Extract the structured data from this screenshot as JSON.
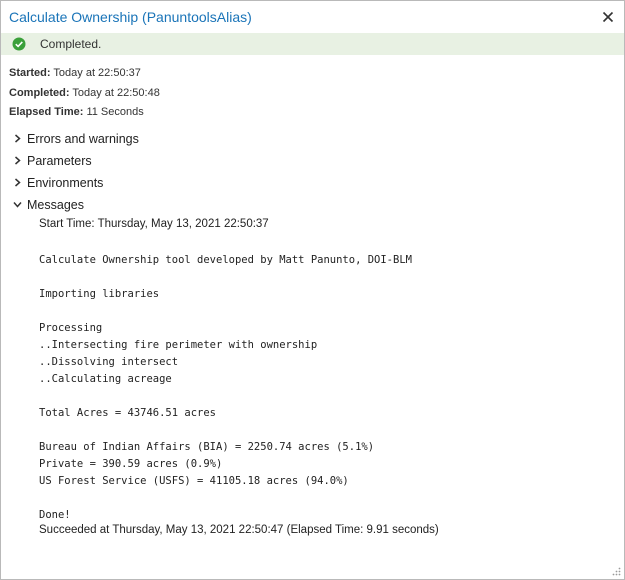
{
  "window": {
    "title": "Calculate Ownership (PanuntoolsAlias)"
  },
  "status": {
    "text": "Completed.",
    "color": "#3aa03a"
  },
  "meta": {
    "started_label": "Started:",
    "started_value": "Today at 22:50:37",
    "completed_label": "Completed:",
    "completed_value": "Today at 22:50:48",
    "elapsed_label": "Elapsed Time:",
    "elapsed_value": "11 Seconds"
  },
  "sections": {
    "errors": "Errors and warnings",
    "parameters": "Parameters",
    "environments": "Environments",
    "messages": "Messages"
  },
  "messages": {
    "start_time": "Start Time: Thursday, May 13, 2021 22:50:37",
    "lines": [
      "",
      "Calculate Ownership tool developed by Matt Panunto, DOI-BLM",
      "",
      "Importing libraries",
      "",
      "Processing",
      "..Intersecting fire perimeter with ownership",
      "..Dissolving intersect",
      "..Calculating acreage",
      "",
      "Total Acres = 43746.51 acres",
      "",
      "Bureau of Indian Affairs (BIA) = 2250.74 acres (5.1%)",
      "Private = 390.59 acres (0.9%)",
      "US Forest Service (USFS) = 41105.18 acres (94.0%)",
      "",
      "Done!"
    ],
    "succeeded": "Succeeded at Thursday, May 13, 2021 22:50:47 (Elapsed Time: 9.91 seconds)"
  },
  "icons": {
    "close": "close-icon",
    "status": "check-circle-icon",
    "collapsed": "chevron-right-icon",
    "expanded": "chevron-down-icon",
    "resize": "resize-grip-icon"
  }
}
